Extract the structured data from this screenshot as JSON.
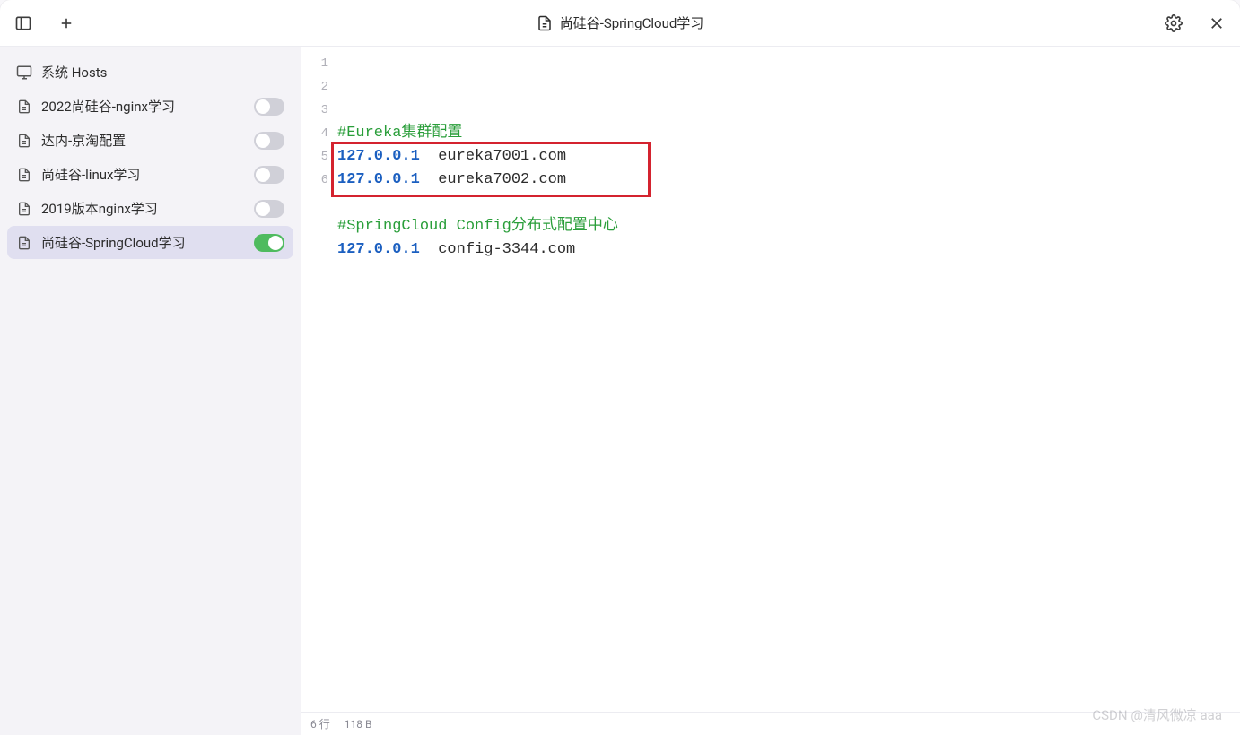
{
  "title": "尚硅谷-SpringCloud学习",
  "sidebar": {
    "items": [
      {
        "label": "系统 Hosts",
        "icon": "monitor",
        "toggle": null,
        "active": false
      },
      {
        "label": "2022尚硅谷-nginx学习",
        "icon": "file",
        "toggle": false,
        "active": false
      },
      {
        "label": "达内-京淘配置",
        "icon": "file",
        "toggle": false,
        "active": false
      },
      {
        "label": "尚硅谷-linux学习",
        "icon": "file",
        "toggle": false,
        "active": false
      },
      {
        "label": "2019版本nginx学习",
        "icon": "file",
        "toggle": false,
        "active": false
      },
      {
        "label": "尚硅谷-SpringCloud学习",
        "icon": "file",
        "toggle": true,
        "active": true
      }
    ]
  },
  "editor": {
    "lines": [
      {
        "n": "1",
        "type": "comment",
        "text": "#Eureka集群配置"
      },
      {
        "n": "2",
        "type": "entry",
        "ip": "127.0.0.1",
        "host": "  eureka7001.com"
      },
      {
        "n": "3",
        "type": "entry",
        "ip": "127.0.0.1",
        "host": "  eureka7002.com"
      },
      {
        "n": "4",
        "type": "blank",
        "text": ""
      },
      {
        "n": "5",
        "type": "comment",
        "text": "#SpringCloud Config分布式配置中心"
      },
      {
        "n": "6",
        "type": "entry",
        "ip": "127.0.0.1",
        "host": "  config-3344.com"
      }
    ]
  },
  "statusbar": {
    "lines": "6 行",
    "bytes": "118 B"
  },
  "watermark": "CSDN @清风微凉 aaa"
}
